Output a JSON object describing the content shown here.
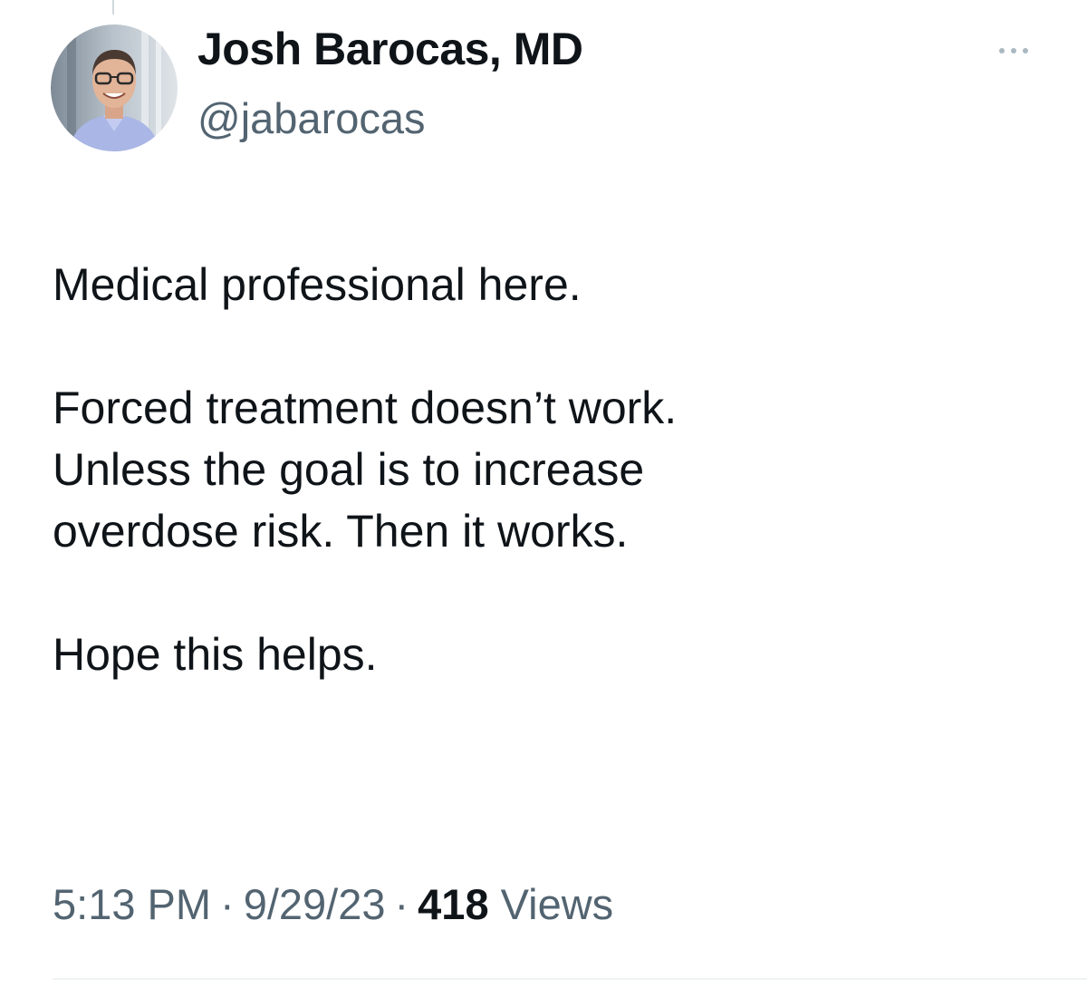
{
  "author": {
    "display_name": "Josh Barocas, MD",
    "handle": "@jabarocas",
    "avatar_icon": "profile-photo"
  },
  "menu": {
    "icon": "more-options-icon"
  },
  "tweet": {
    "paragraphs": [
      [
        "Medical professional here."
      ],
      [
        "Forced treatment doesn’t work.",
        "Unless the goal is to increase",
        "overdose risk. Then it works."
      ],
      [
        "Hope this helps."
      ]
    ]
  },
  "meta": {
    "time": "5:13 PM",
    "date": "9/29/23",
    "separator": "·",
    "views_count": "418",
    "views_label": "Views"
  },
  "colors": {
    "text": "#0f1419",
    "secondary": "#536471",
    "divider": "#eff3f4"
  }
}
